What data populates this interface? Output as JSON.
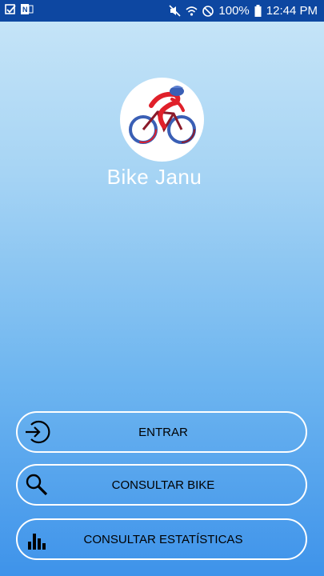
{
  "status_bar": {
    "time": "12:44 PM",
    "battery": "100%",
    "icons_left": [
      "checkbox-notification-icon",
      "onenote-notification-icon"
    ],
    "icons_right": [
      "mute-icon",
      "wifi-icon",
      "do-not-disturb-icon",
      "battery-icon"
    ],
    "background": "#0d47a1"
  },
  "app": {
    "name": "Bike Janu",
    "logo": "cyclist-logo"
  },
  "buttons": [
    {
      "label": "ENTRAR",
      "icon": "login-arrow-icon"
    },
    {
      "label": "CONSULTAR BIKE",
      "icon": "search-icon"
    },
    {
      "label": "CONSULTAR ESTATÍSTICAS",
      "icon": "bar-chart-icon"
    }
  ],
  "colors": {
    "gradient_top": "#c9e6f8",
    "gradient_bottom": "#3e93ea",
    "button_border": "#ffffff",
    "logo_red": "#e0202a",
    "logo_blue": "#3a5fb5"
  }
}
